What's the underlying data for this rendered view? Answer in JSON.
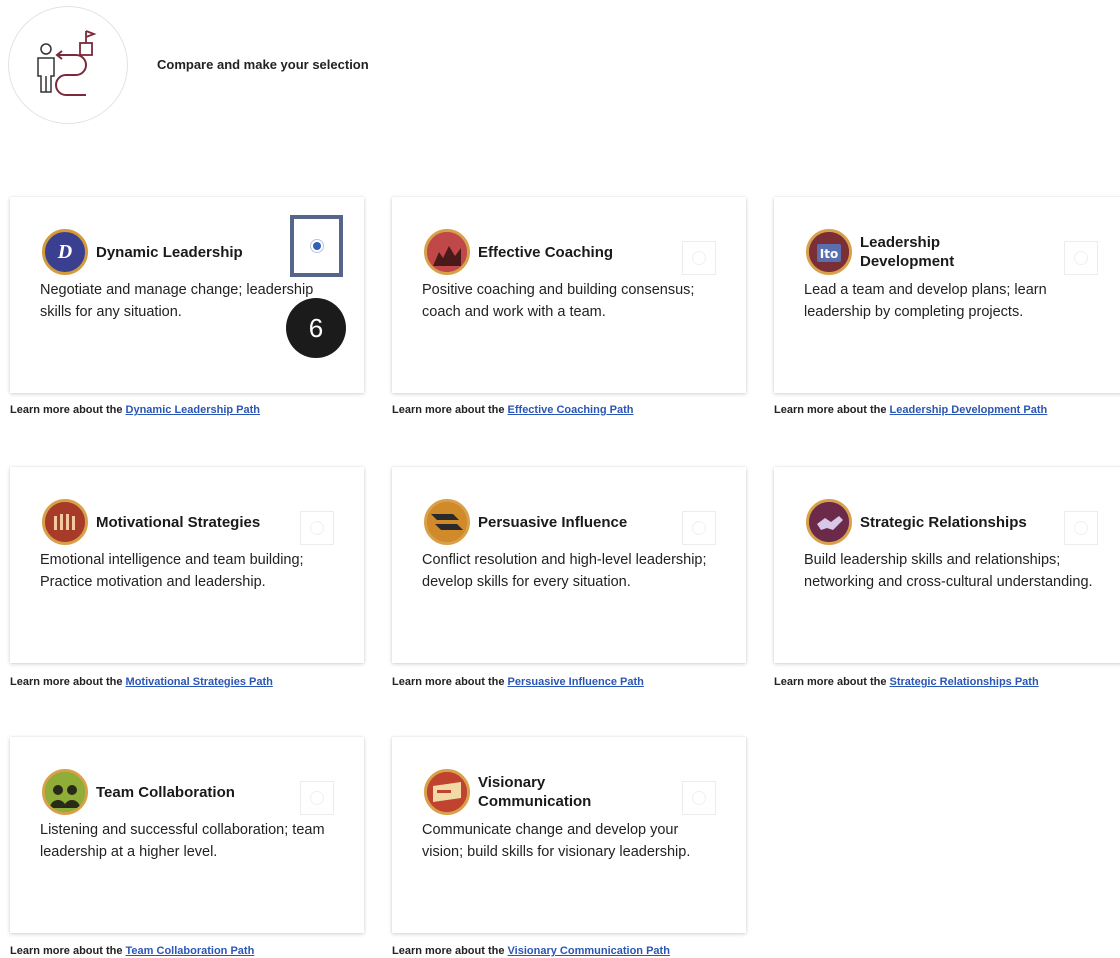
{
  "header": {
    "title": "Compare and make your selection",
    "icon": "person-path-flag-icon"
  },
  "learn_prefix": "Learn more about the ",
  "paths": [
    {
      "title": "Dynamic Leadership",
      "description": "Negotiate and manage change; leadership skills for any situation.",
      "link": "Dynamic Leadership Path",
      "selected": true,
      "badge_color": "#3a3f8f"
    },
    {
      "title": "Effective Coaching",
      "description": "Positive coaching and building consensus; coach and work with a team.",
      "link": "Effective Coaching Path",
      "selected": false,
      "badge_color": "#b03a3a"
    },
    {
      "title": "Leadership Development",
      "description": "Lead a team and develop plans; learn leadership by completing projects.",
      "link": "Leadership Development Path",
      "selected": false,
      "badge_color": "#7a2f36"
    },
    {
      "title": "Motivational Strategies",
      "description": "Emotional intelligence and team building; Practice motivation and leadership.",
      "link": "Motivational Strategies Path",
      "selected": false,
      "badge_color": "#b8452f"
    },
    {
      "title": "Persuasive Influence",
      "description": "Conflict resolution and high-level leadership; develop skills for every situation.",
      "link": "Persuasive Influence Path",
      "selected": false,
      "badge_color": "#c7791f"
    },
    {
      "title": "Strategic Relationships",
      "description": "Build leadership skills and relationships; networking and cross-cultural understanding.",
      "link": "Strategic Relationships Path",
      "selected": false,
      "badge_color": "#6b2a4a"
    },
    {
      "title": "Team Collaboration",
      "description": "Listening and successful collaboration; team leadership at a higher level.",
      "link": "Team Collaboration Path",
      "selected": false,
      "badge_color": "#6c8a2a"
    },
    {
      "title": "Visionary Communication",
      "description": "Communicate change and develop your vision; build skills for visionary leadership.",
      "link": "Visionary Communication Path",
      "selected": false,
      "badge_color": "#c0432f"
    }
  ],
  "step_marker": "6"
}
